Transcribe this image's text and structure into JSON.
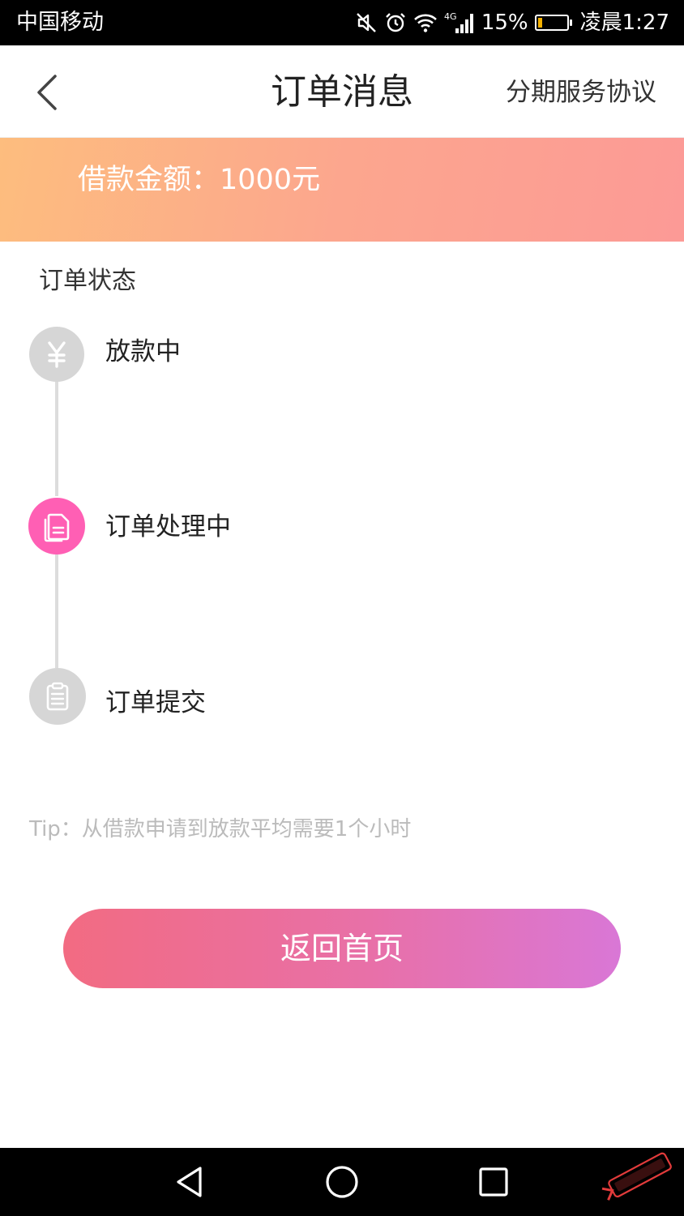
{
  "status_bar": {
    "carrier": "中国移动",
    "network_badge": "4G",
    "battery_percent": "15%",
    "battery_level": 0.15,
    "time": "凌晨1:27",
    "icons": [
      "mute-icon",
      "alarm-icon",
      "wifi-icon",
      "signal-icon",
      "battery-icon"
    ]
  },
  "header": {
    "title": "订单消息",
    "agreement_link": "分期服务协议",
    "back_icon": "chevron-left-icon"
  },
  "banner": {
    "amount_text": "借款金额：1000元",
    "colors": [
      "#fdbd7e",
      "#fc9a96"
    ]
  },
  "order_status": {
    "section_title": "订单状态",
    "steps": [
      {
        "label": "放款中",
        "icon": "yuan-icon",
        "state": "pending"
      },
      {
        "label": "订单处理中",
        "icon": "documents-icon",
        "state": "active"
      },
      {
        "label": "订单提交",
        "icon": "clipboard-icon",
        "state": "done"
      }
    ],
    "active_color": "#ff5fb4"
  },
  "tip": "Tip：从借款申请到放款平均需要1个小时",
  "home_button": {
    "label": "返回首页",
    "colors": [
      "#f26b82",
      "#d977d6"
    ]
  },
  "nav_bar": {
    "icons": [
      "back-triangle-icon",
      "home-circle-icon",
      "recents-square-icon"
    ]
  }
}
